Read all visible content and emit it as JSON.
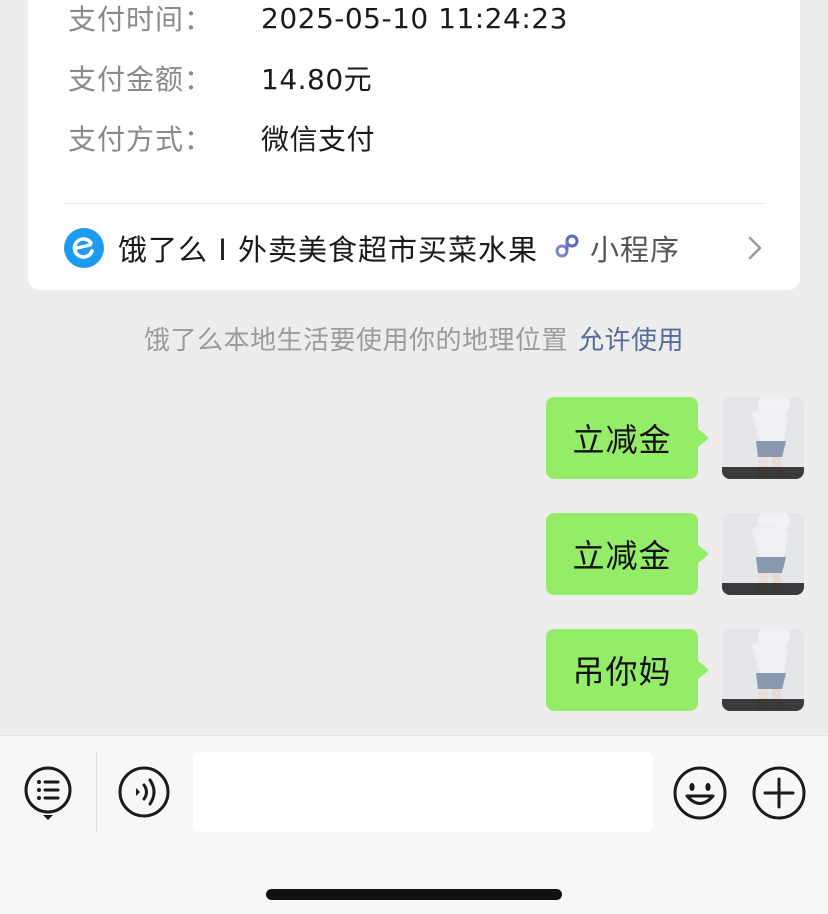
{
  "payment": {
    "rows": [
      {
        "label": "支付时间：",
        "value": "2025-05-10 11:24:23"
      },
      {
        "label": "支付金额：",
        "value": "14.80元"
      },
      {
        "label": "支付方式：",
        "value": "微信支付"
      }
    ],
    "mini_program": {
      "name": "饿了么 I 外卖美食超市买菜水果",
      "tag": "小程序",
      "logo_icon": "eleme-logo-icon",
      "link_icon": "mini-program-icon",
      "chevron_icon": "chevron-right-icon"
    }
  },
  "notice": {
    "text": "饿了么本地生活要使用你的地理位置",
    "link": "允许使用"
  },
  "messages": [
    {
      "text": "立减金"
    },
    {
      "text": "立减金"
    },
    {
      "text": "吊你妈"
    }
  ],
  "input_bar": {
    "placeholder": "",
    "icons": [
      "menu-list-icon",
      "voice-icon",
      "emoji-icon",
      "plus-icon"
    ]
  },
  "colors": {
    "bubble": "#95ec69",
    "background": "#ededed",
    "link": "#576b95",
    "eleme_blue": "#1e9bf0"
  }
}
